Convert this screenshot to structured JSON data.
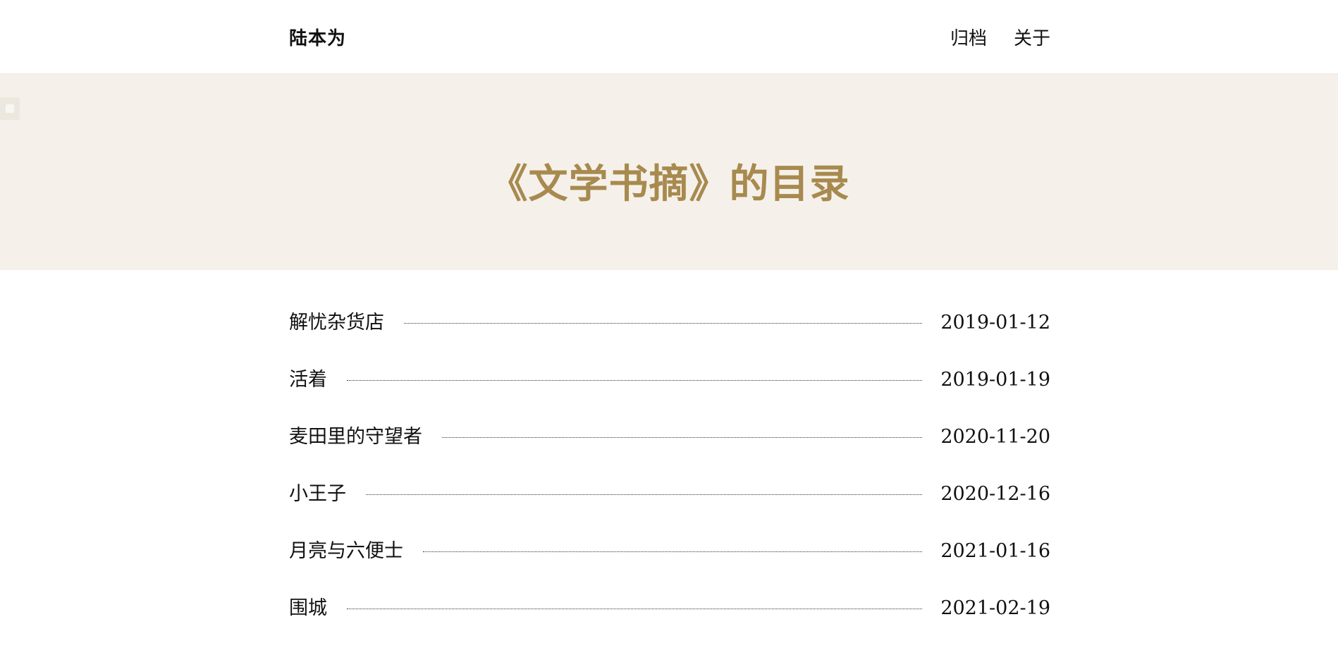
{
  "header": {
    "site_title": "陆本为",
    "nav": [
      {
        "label": "归档"
      },
      {
        "label": "关于"
      }
    ]
  },
  "banner": {
    "title": "《文学书摘》的目录"
  },
  "toc": [
    {
      "title": "解忧杂货店",
      "date": "2019-01-12"
    },
    {
      "title": "活着",
      "date": "2019-01-19"
    },
    {
      "title": "麦田里的守望者",
      "date": "2020-11-20"
    },
    {
      "title": "小王子",
      "date": "2020-12-16"
    },
    {
      "title": "月亮与六便士",
      "date": "2021-01-16"
    },
    {
      "title": "围城",
      "date": "2021-02-19"
    }
  ],
  "colors": {
    "accent": "#a88a4f",
    "banner_bg": "#f5f1ea",
    "text": "#111111"
  }
}
